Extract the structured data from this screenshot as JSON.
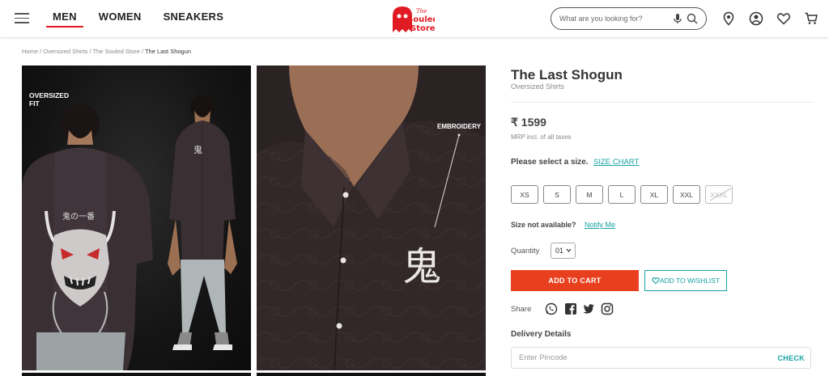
{
  "header": {
    "nav": [
      "MEN",
      "WOMEN",
      "SNEAKERS"
    ],
    "logo_text": [
      "The",
      "Souled",
      "Store"
    ],
    "search_placeholder": "What are you looking for?"
  },
  "breadcrumb": [
    "Home",
    "Oversized Shirts",
    "The Souled Store",
    "The Last Shogun"
  ],
  "gallery": {
    "image1_label_line1": "OVERSIZED",
    "image1_label_line2": "FIT",
    "image2_label": "EMBROIDERY",
    "embroidery_glyph": "鬼"
  },
  "product": {
    "title": "The Last Shogun",
    "category": "Oversized Shirts",
    "price": "₹ 1599",
    "tax_note": "MRP incl. of all taxes",
    "select_size": "Please select a size.",
    "size_chart": "SIZE CHART",
    "sizes": [
      {
        "label": "XS",
        "available": true
      },
      {
        "label": "S",
        "available": true
      },
      {
        "label": "M",
        "available": true
      },
      {
        "label": "L",
        "available": true
      },
      {
        "label": "XL",
        "available": true
      },
      {
        "label": "XXL",
        "available": true
      },
      {
        "label": "XXXL",
        "available": false
      }
    ],
    "size_na": "Size not available?",
    "notify": "Notify Me",
    "quantity_label": "Quantity",
    "quantity_value": "01",
    "add_to_cart": "ADD TO CART",
    "add_to_wishlist": "ADD TO WISHLIST",
    "share_label": "Share",
    "share_icons": [
      "whatsapp-icon",
      "facebook-icon",
      "twitter-icon",
      "instagram-icon"
    ],
    "delivery_title": "Delivery Details",
    "pincode_placeholder": "Enter Pincode",
    "check": "CHECK"
  },
  "colors": {
    "accent_red": "#e8401f",
    "teal": "#17a2a2",
    "nav_underline": "#e11b23"
  }
}
